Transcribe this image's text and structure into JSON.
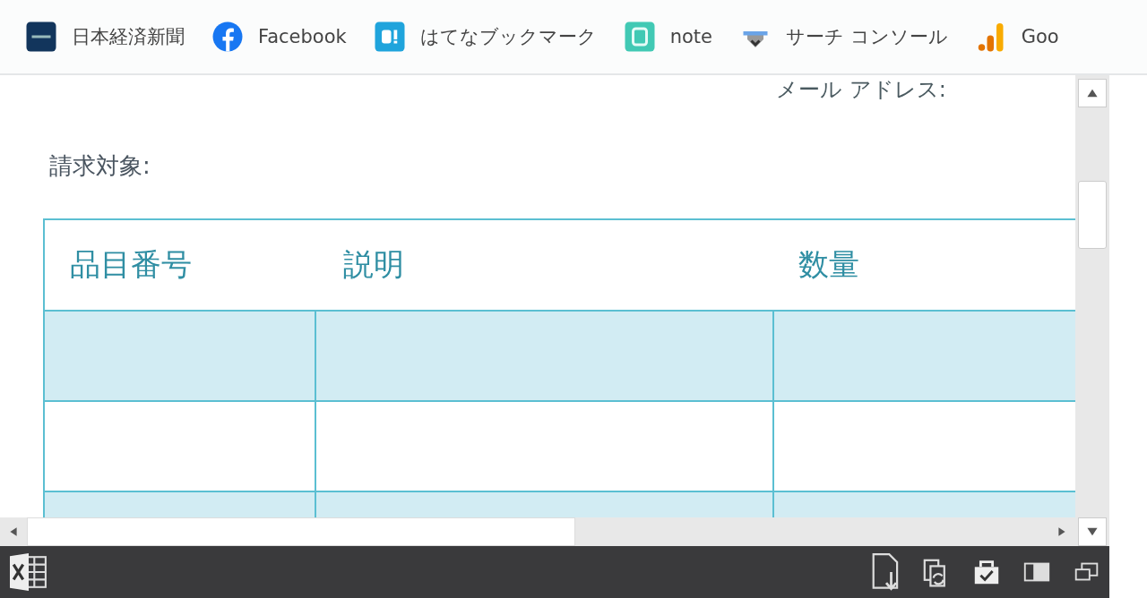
{
  "bookmarks": [
    {
      "label": "日本経済新聞"
    },
    {
      "label": "Facebook"
    },
    {
      "label": "はてなブックマーク"
    },
    {
      "label": "note"
    },
    {
      "label": "サーチ コンソール"
    },
    {
      "label": "Goo"
    }
  ],
  "sheet": {
    "email_label": "メール アドレス:",
    "bill_to_label": "請求対象:",
    "table": {
      "columns": [
        "品目番号",
        "説明",
        "数量"
      ],
      "rows": [
        {
          "shaded": true
        },
        {
          "shaded": false
        },
        {
          "shaded": true
        }
      ]
    }
  }
}
